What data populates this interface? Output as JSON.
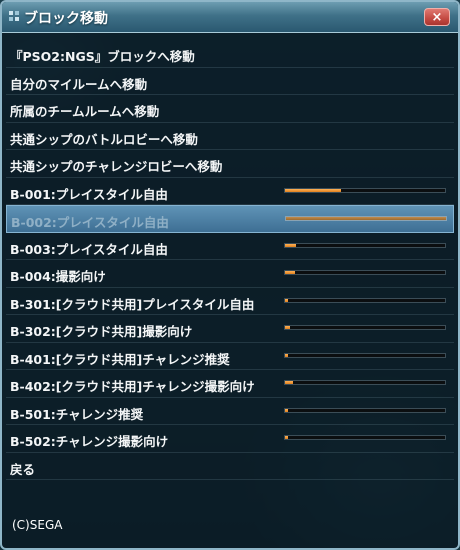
{
  "window": {
    "title": "ブロック移動",
    "close_label": "×"
  },
  "items": [
    {
      "label": "『PSO2:NGS』ブロックへ移動"
    },
    {
      "label": "自分のマイルームへ移動"
    },
    {
      "label": "所属のチームルームへ移動"
    },
    {
      "label": "共通シップのバトルロビーへ移動"
    },
    {
      "label": "共通シップのチャレンジロビーへ移動"
    },
    {
      "label": "B-001:プレイスタイル自由",
      "load": 0.35
    },
    {
      "label": "B-002:プレイスタイル自由",
      "load": 1.0,
      "selected": true
    },
    {
      "label": "B-003:プレイスタイル自由",
      "load": 0.07
    },
    {
      "label": "B-004:撮影向け",
      "load": 0.06
    },
    {
      "label": "B-301:[クラウド共用]プレイスタイル自由",
      "load": 0.02
    },
    {
      "label": "B-302:[クラウド共用]撮影向け",
      "load": 0.03
    },
    {
      "label": "B-401:[クラウド共用]チャレンジ推奨",
      "load": 0.02
    },
    {
      "label": "B-402:[クラウド共用]チャレンジ撮影向け",
      "load": 0.05
    },
    {
      "label": "B-501:チャレンジ推奨",
      "load": 0.02
    },
    {
      "label": "B-502:チャレンジ撮影向け",
      "load": 0.02
    },
    {
      "label": "戻る"
    }
  ],
  "footer": {
    "copyright": "(C)SEGA"
  },
  "colors": {
    "load_bar": "#f09a2e",
    "selected_row": "#4a7ea3",
    "title_bar": "#3f7188"
  }
}
